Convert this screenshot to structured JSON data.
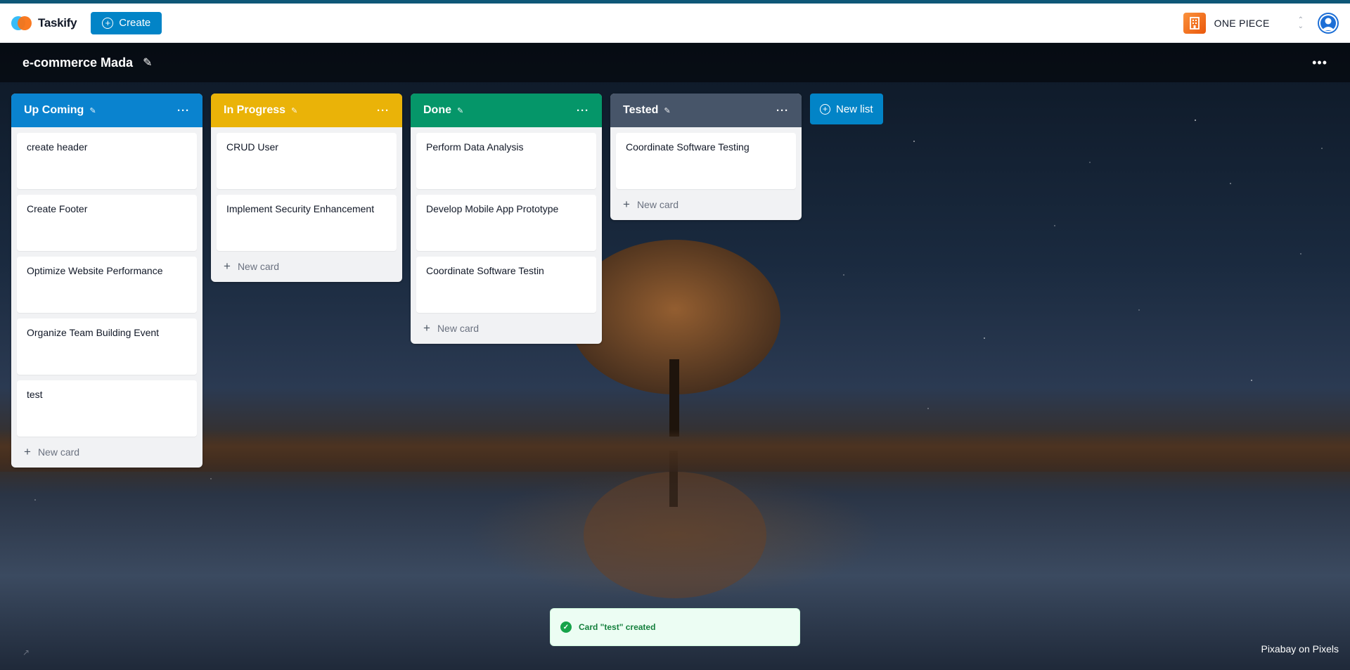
{
  "app": {
    "name": "Taskify"
  },
  "navbar": {
    "create_label": "Create",
    "org_name": "ONE PIECE"
  },
  "board": {
    "title": "e-commerce Mada"
  },
  "lists": [
    {
      "title": "Up Coming",
      "color": "#0a83cf",
      "cards": [
        "create header",
        "Create Footer",
        "Optimize Website Performance",
        "Organize Team Building Event",
        "test"
      ],
      "new_card_label": "New card"
    },
    {
      "title": "In Progress",
      "color": "#eab308",
      "cards": [
        "CRUD User",
        "Implement Security Enhancement"
      ],
      "new_card_label": "New card"
    },
    {
      "title": "Done",
      "color": "#059669",
      "cards": [
        "Perform Data Analysis",
        "Develop Mobile App Prototype",
        "Coordinate Software Testin"
      ],
      "new_card_label": "New card"
    },
    {
      "title": "Tested",
      "color": "#475569",
      "cards": [
        "Coordinate Software Testing"
      ],
      "new_card_label": "New card"
    }
  ],
  "new_list_label": "New list",
  "toast": {
    "message": "Card \"test\" created"
  },
  "credit": "Pixabay on Pixels",
  "colors": {
    "primary": "#0284c7",
    "success": "#16a34a"
  }
}
